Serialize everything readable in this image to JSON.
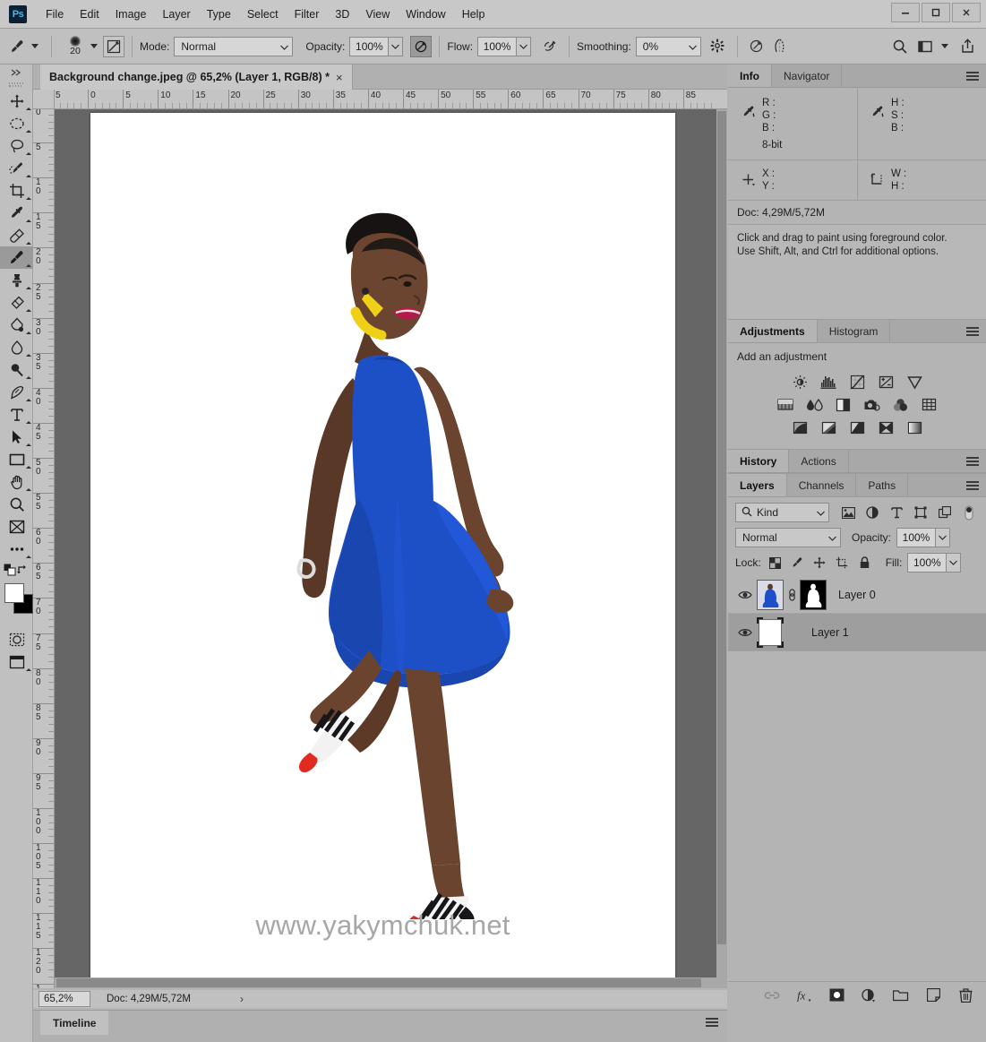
{
  "titlebar": {
    "app_logo": "Ps",
    "menus": [
      "File",
      "Edit",
      "Image",
      "Layer",
      "Type",
      "Select",
      "Filter",
      "3D",
      "View",
      "Window",
      "Help"
    ],
    "window_controls": [
      "minimize-icon",
      "maximize-icon",
      "close-icon"
    ]
  },
  "options_bar": {
    "tool_icon": "brush-tool-icon",
    "brush_size": "20",
    "brush_panel_icon": "brush-settings-icon",
    "mode_label": "Mode:",
    "mode_value": "Normal",
    "opacity_label": "Opacity:",
    "opacity_value": "100%",
    "opacity_pressure_icon": "pressure-opacity-icon",
    "flow_label": "Flow:",
    "flow_value": "100%",
    "airbrush_icon": "airbrush-icon",
    "smoothing_label": "Smoothing:",
    "smoothing_value": "0%",
    "smoothing_options_icon": "gear-icon",
    "angle_icon": "brush-angle-icon",
    "symmetry_icon": "symmetry-icon",
    "search_icon": "search-icon",
    "workspace_icon": "workspace-icon",
    "share_icon": "share-icon"
  },
  "toolbar": {
    "tools": [
      {
        "name": "move-tool",
        "selected": false
      },
      {
        "name": "marquee-tool",
        "selected": false
      },
      {
        "name": "lasso-tool",
        "selected": false
      },
      {
        "name": "quick-selection-tool",
        "selected": false
      },
      {
        "name": "crop-tool",
        "selected": false
      },
      {
        "name": "eyedropper-tool",
        "selected": false
      },
      {
        "name": "healing-brush-tool",
        "selected": false
      },
      {
        "name": "brush-tool",
        "selected": true
      },
      {
        "name": "clone-stamp-tool",
        "selected": false
      },
      {
        "name": "eraser-tool",
        "selected": false
      },
      {
        "name": "gradient-tool",
        "selected": false
      },
      {
        "name": "blur-tool",
        "selected": false
      },
      {
        "name": "dodge-tool",
        "selected": false
      },
      {
        "name": "pen-tool",
        "selected": false
      },
      {
        "name": "type-tool",
        "selected": false
      },
      {
        "name": "path-selection-tool",
        "selected": false
      },
      {
        "name": "rectangle-tool",
        "selected": false
      },
      {
        "name": "hand-tool",
        "selected": false
      },
      {
        "name": "zoom-tool",
        "selected": false
      },
      {
        "name": "frame-tool",
        "selected": false
      },
      {
        "name": "edit-toolbar-tool",
        "selected": false
      }
    ],
    "foreground_color": "#ffffff",
    "background_color": "#000000",
    "quick_mask_icon": "quick-mask-icon",
    "screen_mode_icon": "screen-mode-icon"
  },
  "document": {
    "tab_title": "Background change.jpeg @ 65,2% (Layer 1, RGB/8) *",
    "close_label": "×",
    "watermark": "www.yakymchuk.net",
    "ruler_h_labels": [
      "5",
      "0",
      "5",
      "10",
      "15",
      "20",
      "25",
      "30",
      "35",
      "40",
      "45",
      "50",
      "55",
      "60",
      "65",
      "70",
      "75",
      "80",
      "85"
    ],
    "ruler_v_labels": [
      "0",
      "5",
      "10",
      "15",
      "20",
      "25",
      "30",
      "35",
      "40",
      "45",
      "50",
      "55",
      "60",
      "65",
      "70",
      "75",
      "80",
      "85",
      "90",
      "95",
      "100",
      "105",
      "110",
      "115",
      "120",
      "1"
    ]
  },
  "status_bar": {
    "zoom_value": "65,2%",
    "doc_info": "Doc: 4,29M/5,72M",
    "expand_arrow": "›"
  },
  "timeline": {
    "tab_label": "Timeline",
    "menu_icon": "panel-menu-icon"
  },
  "info_panel": {
    "tabs": [
      {
        "label": "Info",
        "active": true
      },
      {
        "label": "Navigator",
        "active": false
      }
    ],
    "rgb": {
      "r_label": "R :",
      "g_label": "G :",
      "b_label": "B :",
      "icon": "eyedropper-icon"
    },
    "hsb": {
      "h_label": "H :",
      "s_label": "S :",
      "b_label": "B :",
      "icon": "eyedropper-icon"
    },
    "bit_depth": "8-bit",
    "coords": {
      "x_label": "X :",
      "y_label": "Y :",
      "icon": "crosshair-icon"
    },
    "size": {
      "w_label": "W :",
      "h_label": "H :",
      "icon": "selection-size-icon"
    },
    "doc_line": "Doc: 4,29M/5,72M",
    "hint_line1": "Click and drag to paint using foreground color.",
    "hint_line2": "Use Shift, Alt, and Ctrl for additional options."
  },
  "adjustments_panel": {
    "tabs": [
      {
        "label": "Adjustments",
        "active": true
      },
      {
        "label": "Histogram",
        "active": false
      }
    ],
    "title": "Add an adjustment",
    "rows": [
      [
        "brightness-contrast-icon",
        "levels-icon",
        "curves-icon",
        "exposure-icon",
        "vibrance-icon"
      ],
      [
        "hue-saturation-icon",
        "color-balance-icon",
        "black-white-icon",
        "photo-filter-icon",
        "channel-mixer-icon",
        "color-lookup-icon"
      ],
      [
        "invert-icon",
        "posterize-icon",
        "threshold-icon",
        "gradient-map-icon",
        "selective-color-icon"
      ]
    ]
  },
  "history_panel": {
    "tabs": [
      {
        "label": "History",
        "active": true
      },
      {
        "label": "Actions",
        "active": false
      }
    ]
  },
  "layers_panel": {
    "tabs": [
      {
        "label": "Layers",
        "active": true
      },
      {
        "label": "Channels",
        "active": false
      },
      {
        "label": "Paths",
        "active": false
      }
    ],
    "filter_kind": "Kind",
    "filter_search_icon": "search-icon",
    "filter_icons": [
      "pixel-filter-icon",
      "adjustment-filter-icon",
      "type-filter-icon",
      "shape-filter-icon",
      "smart-object-filter-icon",
      "filter-toggle-icon"
    ],
    "blend_mode": "Normal",
    "opacity_label": "Opacity:",
    "opacity_value": "100%",
    "lock_label": "Lock:",
    "lock_icons": [
      "lock-transparent-pixels-icon",
      "lock-image-pixels-icon",
      "lock-position-icon",
      "lock-artboard-icon",
      "lock-all-icon"
    ],
    "fill_label": "Fill:",
    "fill_value": "100%",
    "layers": [
      {
        "name": "Layer 0",
        "visible": true,
        "selected": false,
        "has_mask": true,
        "linked": true
      },
      {
        "name": "Layer 1",
        "visible": true,
        "selected": true,
        "has_mask": false,
        "linked": false
      }
    ],
    "footer_icons": [
      "link-layers-icon",
      "layer-style-fx-icon",
      "add-layer-mask-icon",
      "new-adjustment-layer-icon",
      "new-group-icon",
      "new-layer-icon",
      "delete-layer-icon"
    ]
  },
  "colors": {
    "panel_bg": "#b4b4b4",
    "chrome_bg": "#c0c0c0",
    "canvas_bg": "#666666",
    "selection_highlight": "#9e9e9e",
    "dress_blue": "#1f51c4",
    "accent_yellow": "#f2d218",
    "shoe_red": "#e02b20"
  }
}
